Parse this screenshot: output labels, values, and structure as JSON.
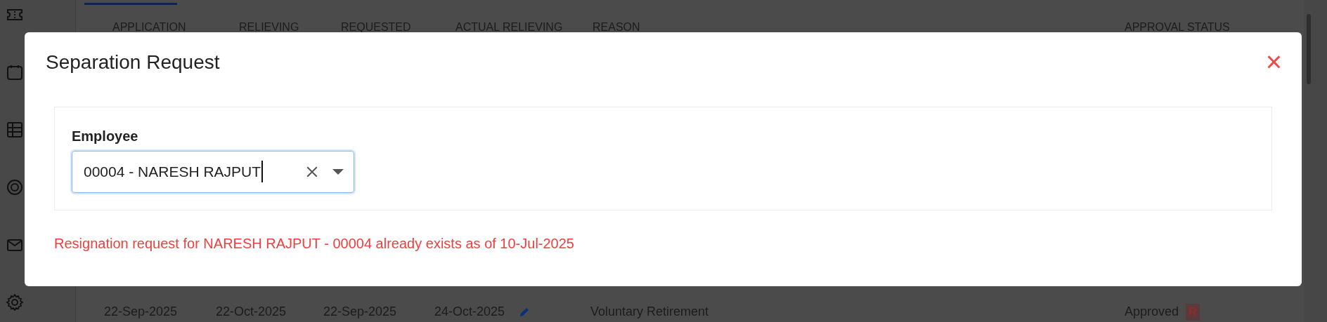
{
  "background_page": {
    "table": {
      "columns": [
        "APPLICATION",
        "RELIEVING",
        "REQUESTED",
        "ACTUAL RELIEVING",
        "REASON",
        "APPROVAL STATUS"
      ],
      "rows": [
        {
          "cells": [
            "22-Sep-2025",
            "22-Oct-2025",
            "22-Sep-2025",
            "24-Oct-2025",
            "Voluntary Retirement",
            "Approved"
          ],
          "badge": "R"
        }
      ]
    }
  },
  "modal": {
    "title": "Separation Request",
    "close": "×",
    "field": {
      "label": "Employee",
      "value": "00004 - NARESH RAJPUT",
      "focused": true
    },
    "error": "Resignation request for NARESH RAJPUT - 00004 already exists as of 10-Jul-2025"
  }
}
